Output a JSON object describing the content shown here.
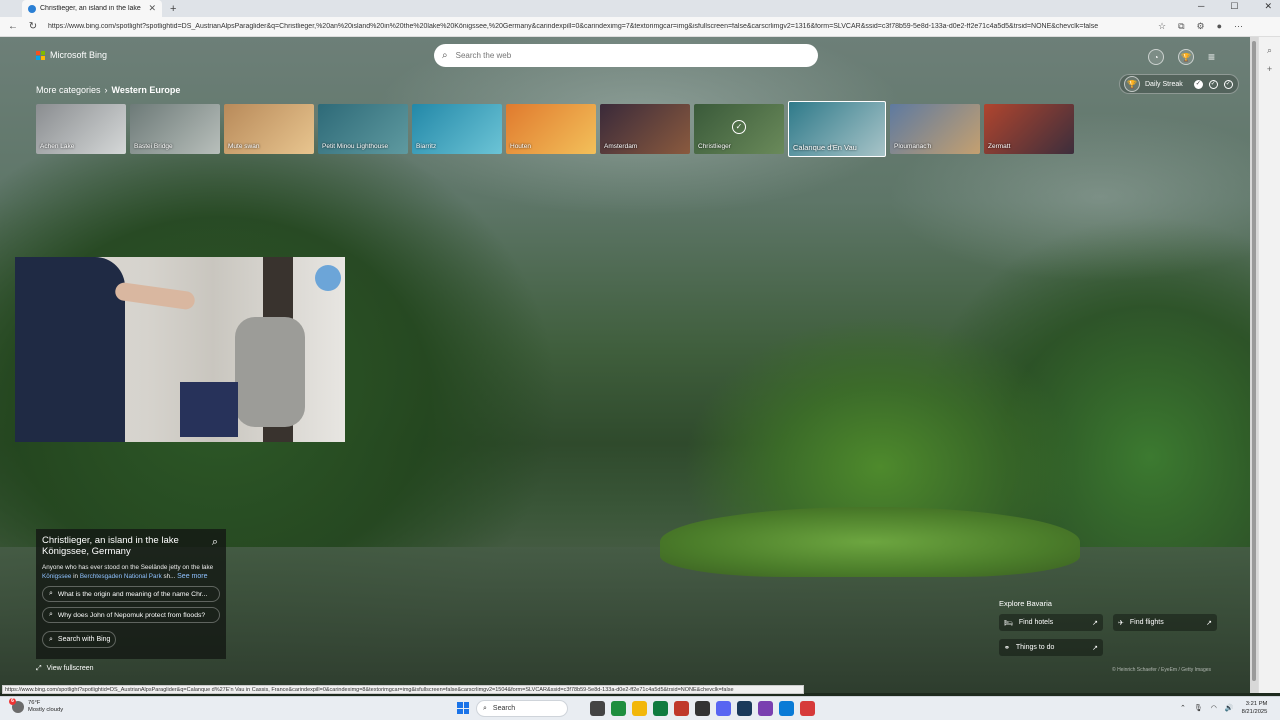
{
  "browser": {
    "tab_title": "Christlieger, an island in the lake",
    "url": "https://www.bing.com/spotlight?spotlightid=DS_AustrianAlpsParaglider&q=Christlieger,%20an%20island%20in%20the%20lake%20Königssee,%20Germany&carindexpill=0&carindeximg=7&textorimgcar=img&isfullscreen=false&carscrlimgv2=1316&form=SLVCAR&ssid=c3f78b59-5e8d-133a-d0e2-ff2e71c4a5d5&trsid=NONE&chevclk=false",
    "status_url": "https://www.bing.com/spotlight?spotlightid=DS_AustrianAlpsParaglider&q=Calanque d%27E'n Vau in Cassis, France&carindexpill=0&carindeximg=8&textorimgcar=img&isfullscreen=false&carscrlimgv2=1504&form=SLVCAR&ssid=c3f78b59-5e8d-133a-d0e2-ff2e71c4a5d5&trsid=NONE&chevclk=false"
  },
  "header": {
    "brand": "Microsoft Bing",
    "search_placeholder": "Search the web",
    "streak_label": "Daily Streak",
    "streak_points": [
      "+100",
      "+150",
      "+250"
    ]
  },
  "categories": {
    "more_label": "More categories",
    "current": "Western Europe"
  },
  "thumbnails": [
    {
      "label": "Achen Lake",
      "colors": [
        "#8a8d90",
        "#d5d8d8"
      ]
    },
    {
      "label": "Bastei Bridge",
      "colors": [
        "#6d7a78",
        "#b8bfbb"
      ]
    },
    {
      "label": "Mute swan",
      "colors": [
        "#b88a5a",
        "#e8c58f"
      ]
    },
    {
      "label": "Petit Minou Lighthouse",
      "colors": [
        "#2e6a78",
        "#5f9aa0"
      ]
    },
    {
      "label": "Biarritz",
      "colors": [
        "#2388a8",
        "#6cc4d6"
      ]
    },
    {
      "label": "Houten",
      "colors": [
        "#e07a2e",
        "#f3c05a"
      ]
    },
    {
      "label": "Amsterdam",
      "colors": [
        "#3a2a3a",
        "#8a5a3e"
      ]
    },
    {
      "label": "Christlieger",
      "colors": [
        "#3a5a3a",
        "#6a8a5a"
      ]
    },
    {
      "label": "Calanque d'En Vau",
      "colors": [
        "#2f7a8a",
        "#a8c4c8"
      ]
    },
    {
      "label": "Ploumanac'h",
      "colors": [
        "#5e7aa0",
        "#c4a070"
      ]
    },
    {
      "label": "Zermatt",
      "colors": [
        "#b0452e",
        "#3c2e3c"
      ]
    }
  ],
  "info": {
    "title": "Christlieger, an island in the lake Königssee, Germany",
    "desc_start": "Anyone who has ever stood on the Seelände jetty on the lake",
    "link1": "Königssee",
    "mid": " in ",
    "link2": "Berchtesgaden National Park",
    "desc_end": " sh...",
    "see_more": "See more",
    "questions": [
      "What is the origin and meaning of the name Chr...",
      "Why does John of Nepomuk protect from floods?"
    ],
    "search_btn": "Search with Bing"
  },
  "view_fullscreen": "View fullscreen",
  "explore": {
    "title": "Explore Bavaria",
    "hotels": "Find hotels",
    "flights": "Find flights",
    "todo": "Things to do"
  },
  "credit": "© Heinrich Schaefer / EyeEm / Getty Images",
  "taskbar": {
    "temp": "76°F",
    "condition": "Mostly cloudy",
    "badge": "6",
    "search": "Search",
    "time": "3:21 PM",
    "date": "8/21/2025"
  }
}
